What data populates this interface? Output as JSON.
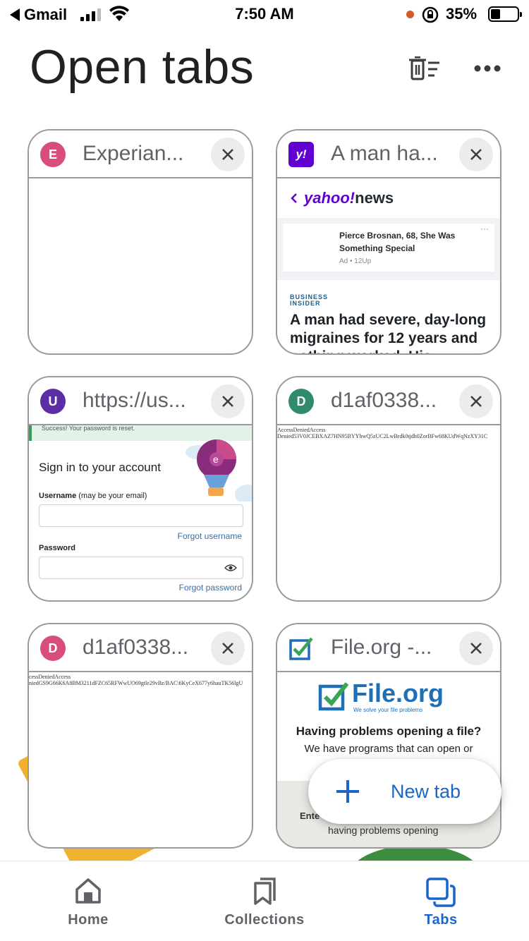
{
  "status_bar": {
    "back_app": "Gmail",
    "time": "7:50 AM",
    "battery_pct": "35%"
  },
  "header": {
    "title": "Open tabs",
    "actions": [
      "delete-all-tabs-icon",
      "more-options-icon"
    ]
  },
  "tabs": [
    {
      "title": "Experian...",
      "favicon_letter": "E",
      "favicon_color": "#d94d7a",
      "content_type": "blank"
    },
    {
      "title": "A man ha...",
      "favicon_letter": "y!",
      "favicon_color": "#6001d2",
      "content": {
        "brand_yahoo": "yahoo!",
        "brand_news": "news",
        "ad_headline": "Pierce Brosnan, 68, She Was Something Special",
        "ad_source": "Ad • 12Up",
        "ad_dots": "···",
        "source_line1": "BUSINESS",
        "source_line2": "INSIDER",
        "article_headline": "A man had severe, day-long migraines for 12 years and nothing worked. His doctors"
      }
    },
    {
      "title": "https://us...",
      "favicon_letter": "U",
      "favicon_color": "#5b2ea6",
      "content": {
        "success_message": "Success! Your password is reset.",
        "heading": "Sign in to your account",
        "username_label": "Username",
        "username_hint": " (may be your email)",
        "forgot_username": "Forgot username",
        "password_label": "Password",
        "forgot_password": "Forgot password"
      }
    },
    {
      "title": "d1af0338...",
      "favicon_letter": "D",
      "favicon_color": "#2f8a6e",
      "content": {
        "line1": "AccessDeniedAccess",
        "line2": "Denied53V0JCEBXAZ7HN95BYYhwQ5zUC2LwBrdk0tjdh0ZorBFw68KUdWqNzXY31C"
      }
    },
    {
      "title": "d1af0338...",
      "favicon_letter": "D",
      "favicon_color": "#d94d7a",
      "content": {
        "line1": "cessDeniedAccess",
        "line2": "niedGS9G66K6A8BM3211dFZC65RFWwUO69gtle29vBz/BAC\\6KyCeX677y6hauTK56lgU"
      }
    },
    {
      "title": "File.org -...",
      "favicon_letter": "✓",
      "favicon_color": "#1e6fb8",
      "content": {
        "logo_text": "File.org",
        "logo_tagline": "We solve your file problems",
        "question": "Having problems opening a file?",
        "text": "We have programs that can open or",
        "enter_text": "Ente",
        "having_text": "having problems opening"
      }
    }
  ],
  "fab": {
    "label": "New tab"
  },
  "bottom_nav": {
    "items": [
      {
        "label": "Home",
        "icon": "home-icon",
        "active": false
      },
      {
        "label": "Collections",
        "icon": "collections-icon",
        "active": false
      },
      {
        "label": "Tabs",
        "icon": "tabs-icon",
        "active": true
      }
    ]
  },
  "colors": {
    "accent": "#1a66c9",
    "card_border": "#9a9a9a"
  }
}
